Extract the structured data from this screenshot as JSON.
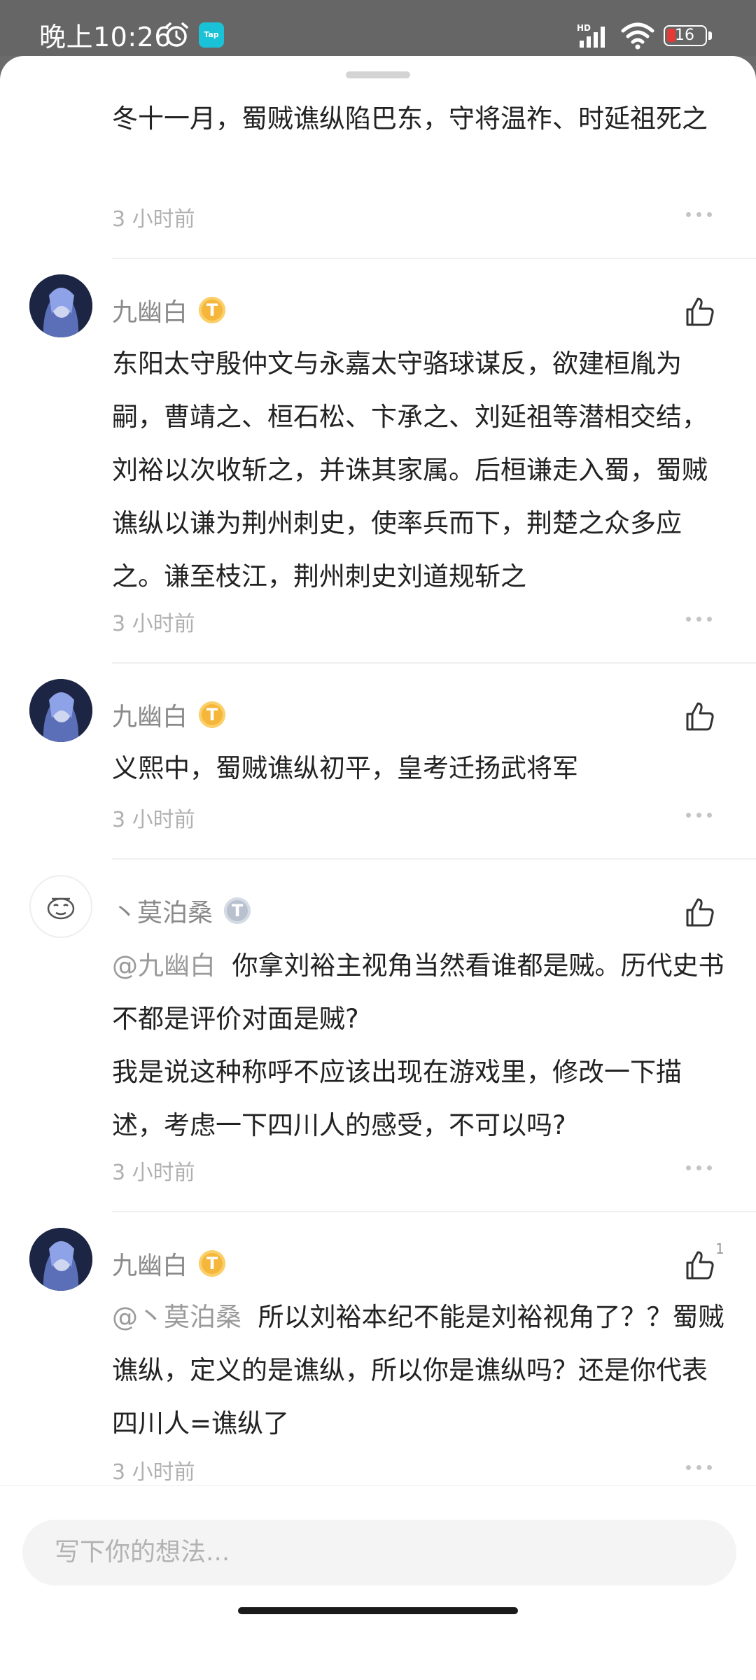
{
  "status_bar": {
    "time": "晚上10:26",
    "tap_label": "Tap",
    "network": "HD",
    "battery": "16"
  },
  "comments": [
    {
      "body": "冬十一月，蜀贼谯纵陷巴东，守将温祚、时延祖死之",
      "time": "3 小时前"
    },
    {
      "name": "九幽白",
      "badge": "T",
      "body": "东阳太守殷仲文与永嘉太守骆球谋反，欲建桓胤为嗣，曹靖之、桓石松、卞承之、刘延祖等潜相交结，刘裕以次收斩之，并诛其家属。后桓谦走入蜀，蜀贼谯纵以谦为荆州刺史，使率兵而下，荆楚之众多应之。谦至枝江，荆州刺史刘道规斩之",
      "time": "3 小时前"
    },
    {
      "name": "九幽白",
      "badge": "T",
      "body": "义熙中，蜀贼谯纵初平，皇考迁扬武将军",
      "time": "3 小时前"
    },
    {
      "name": "丶莫泊桑",
      "badge": "T",
      "mention": "@九幽白",
      "body": "你拿刘裕主视角当然看谁都是贼。历代史书不都是评价对面是贼?",
      "body2": "我是说这种称呼不应该出现在游戏里，修改一下描述，考虑一下四川人的感受，不可以吗?",
      "time": "3 小时前"
    },
    {
      "name": "九幽白",
      "badge": "T",
      "like_count": "1",
      "mention": "@丶莫泊桑",
      "body": "所以刘裕本纪不能是刘裕视角了？？蜀贼谯纵，定义的是谯纵，所以你是谯纵吗？还是你代表四川人=谯纵了",
      "time": "3 小时前"
    }
  ],
  "input": {
    "placeholder": "写下你的想法..."
  },
  "colors": {
    "accent_badge": "#f5b73b",
    "silver_badge": "#b9c1cf",
    "text_primary": "#222222",
    "text_muted": "#8a8a8a"
  }
}
